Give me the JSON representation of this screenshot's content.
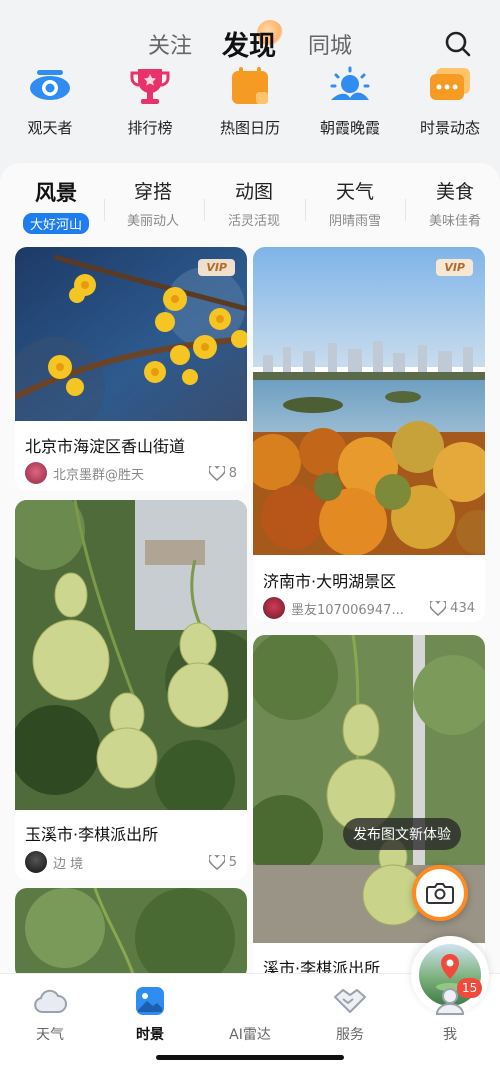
{
  "top_tabs": [
    {
      "label": "关注"
    },
    {
      "label": "发现"
    },
    {
      "label": "同城"
    }
  ],
  "quick_links": [
    {
      "label": "观天者",
      "icon": "eye-icon",
      "color": "#2f8cf0"
    },
    {
      "label": "排行榜",
      "icon": "trophy-icon",
      "color": "#e8336a"
    },
    {
      "label": "热图日历",
      "icon": "calendar-icon",
      "color": "#f59a23"
    },
    {
      "label": "朝霞晚霞",
      "icon": "sunrise-icon",
      "color": "#2f8cf0"
    },
    {
      "label": "时景动态",
      "icon": "messages-icon",
      "color": "#f59a23"
    }
  ],
  "categories": [
    {
      "title": "风景",
      "subtitle": "大好河山",
      "active": true
    },
    {
      "title": "穿搭",
      "subtitle": "美丽动人"
    },
    {
      "title": "动图",
      "subtitle": "活灵活现"
    },
    {
      "title": "天气",
      "subtitle": "阴晴雨雪"
    },
    {
      "title": "美食",
      "subtitle": "美味佳肴"
    }
  ],
  "cards": [
    {
      "title": "北京市海淀区香山街道",
      "author": "北京墨群@胜天",
      "likes": "8",
      "vip": "VIP"
    },
    {
      "title": "济南市·大明湖景区",
      "author": "墨友107006947...",
      "likes": "434",
      "vip": "VIP"
    },
    {
      "title": "玉溪市·李棋派出所",
      "author": "边 境",
      "likes": "5"
    },
    {
      "title": "溪市·李棋派出所"
    }
  ],
  "publish_tip": "发布图文新体验",
  "bottom_nav": [
    {
      "label": "天气",
      "icon": "cloud-icon"
    },
    {
      "label": "时景",
      "icon": "photo-icon",
      "active": true
    },
    {
      "label": "AI雷达",
      "icon": "map-pin-icon"
    },
    {
      "label": "服务",
      "icon": "handshake-icon"
    },
    {
      "label": "我",
      "icon": "user-icon",
      "badge": "15"
    }
  ],
  "colors": {
    "accent": "#1e7ef0",
    "orange": "#ff8a1f",
    "badge": "#f04a3c"
  }
}
